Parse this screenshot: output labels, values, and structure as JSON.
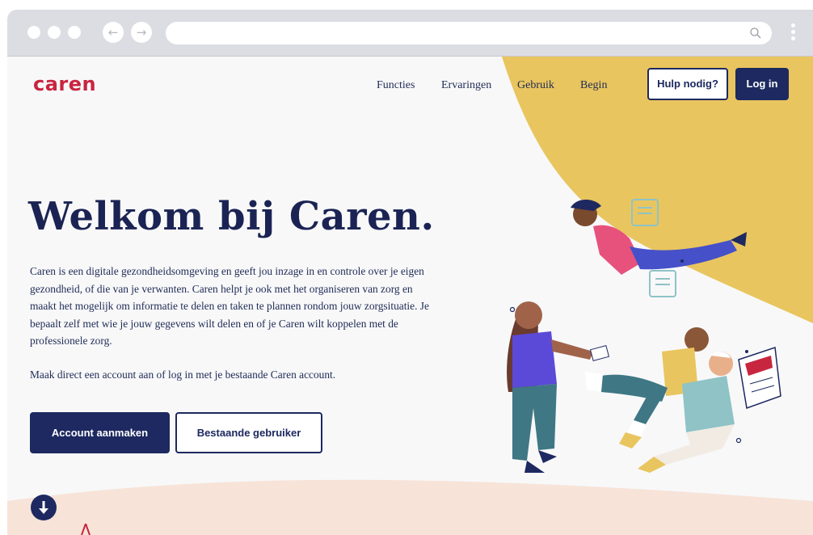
{
  "browser": {
    "icons": {
      "back": "arrow-left-icon",
      "forward": "arrow-right-icon",
      "search": "search-icon",
      "menu": "kebab-menu-icon"
    }
  },
  "header": {
    "logo": "caren",
    "nav": [
      "Functies",
      "Ervaringen",
      "Gebruik",
      "Begin"
    ],
    "help_label": "Hulp nodig?",
    "login_label": "Log in"
  },
  "hero": {
    "title": "Welkom bij Caren.",
    "intro": "Caren is een digitale gezondheidsomgeving en geeft jou inzage in en controle over je eigen gezondheid, of die van je verwanten. Caren helpt je ook met het organiseren van zorg en maakt het mogelijk om informatie te delen en taken te plannen rondom jouw zorgsituatie. Je bepaalt zelf met wie je jouw gegevens wilt delen en of je Caren wilt koppelen met de professionele zorg.",
    "intro2": "Maak direct een account aan of log in met je bestaande Caren account.",
    "primary_label": "Account aanmaken",
    "secondary_label": "Bestaande gebruiker",
    "scroll_icon": "arrow-down-icon"
  },
  "colors": {
    "brand_red": "#c8253f",
    "navy": "#1d2960",
    "yellow": "#e9c55f",
    "wave": "#f7e3d8"
  }
}
